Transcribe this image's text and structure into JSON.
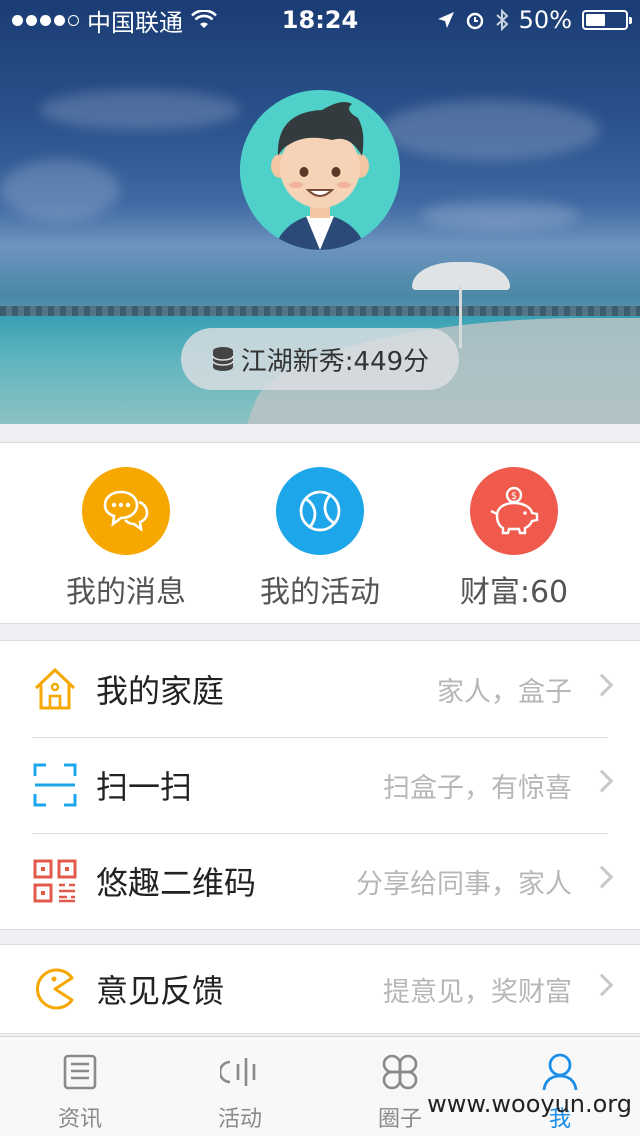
{
  "status_bar": {
    "carrier": "中国联通",
    "time": "18:24",
    "battery": "50%",
    "battery_level": 0.5
  },
  "profile": {
    "score_text": "江湖新秀:449分"
  },
  "quick_actions": [
    {
      "label": "我的消息",
      "color": "#f6a700",
      "icon": "chat-bubbles-icon"
    },
    {
      "label": "我的活动",
      "color": "#1ea6ea",
      "icon": "ball-icon"
    },
    {
      "label": "财富:60",
      "color": "#ef5a4c",
      "icon": "piggy-bank-icon"
    }
  ],
  "menu": {
    "family": {
      "title": "我的家庭",
      "hint": "家人，盒子",
      "icon": "house-icon"
    },
    "scan": {
      "title": "扫一扫",
      "hint": "扫盒子，有惊喜",
      "icon": "scan-icon"
    },
    "qrcode": {
      "title": "悠趣二维码",
      "hint": "分享给同事，家人",
      "icon": "qrcode-icon"
    },
    "feedback": {
      "title": "意见反馈",
      "hint": "提意见，奖财富",
      "icon": "pacman-icon"
    }
  },
  "tabs": [
    {
      "label": "资讯",
      "icon": "news-icon",
      "active": false
    },
    {
      "label": "活动",
      "icon": "activity-icon",
      "active": false
    },
    {
      "label": "圈子",
      "icon": "circle-icon",
      "active": false
    },
    {
      "label": "我",
      "icon": "profile-icon",
      "active": true
    }
  ],
  "colors": {
    "accent": "#1a8ee8",
    "avatar_bg": "#4fd1c9"
  },
  "watermark": "www.wooyun.org"
}
